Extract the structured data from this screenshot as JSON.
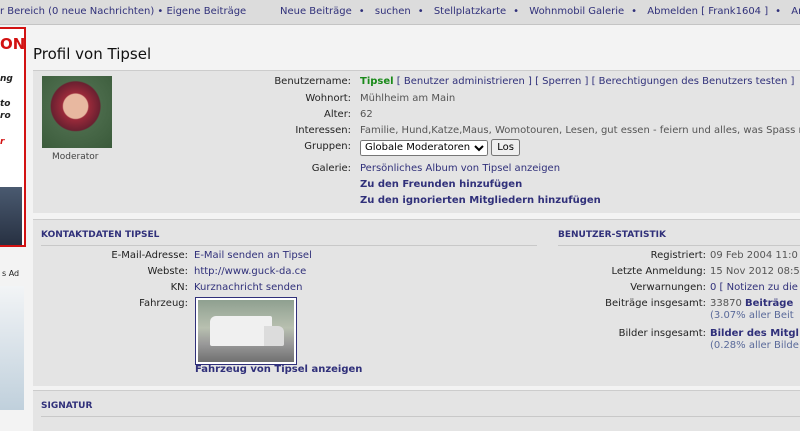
{
  "topnav": {
    "left_text": "r Bereich (0 neue Nachrichten) • Eigene Beiträge",
    "links": [
      "Neue Beiträge",
      "suchen",
      "Stellplatzkarte",
      "Wohnmobil Galerie",
      "Abmelden [ Frank1604 ]",
      "Anzeigen"
    ]
  },
  "ads": {
    "top_headline": "ON",
    "lines": [
      "ng",
      "to",
      "ro",
      "r"
    ],
    "label": "s Ad"
  },
  "page_title": "Profil von Tipsel",
  "profile": {
    "role": "Moderator",
    "rows": [
      {
        "label": "Benutzername:",
        "value": "Tipsel",
        "admin_links": "[ Benutzer administrieren ] [ Sperren ] [ Berechtigungen des Benutzers testen ]"
      },
      {
        "label": "Wohnort:",
        "value": "Mühlheim am Main"
      },
      {
        "label": "Alter:",
        "value": "62"
      },
      {
        "label": "Interessen:",
        "value": "Familie, Hund,Katze,Maus, Womotouren, Lesen, gut essen - feiern und alles, was Spass macht"
      }
    ],
    "groups_label": "Gruppen:",
    "groups_selected": "Globale Moderatoren",
    "go_button": "Los",
    "gallery_label": "Galerie:",
    "gallery_link": "Persönliches Album von Tipsel anzeigen",
    "friend_link": "Zu den Freunden hinzufügen",
    "ignore_link": "Zu den ignorierten Mitgliedern hinzufügen"
  },
  "contact": {
    "header": "KONTAKTDATEN TIPSEL",
    "email_label": "E-Mail-Adresse:",
    "email_value": "E-Mail senden an Tipsel",
    "website_label": "Webste:",
    "website_value": "http://www.guck-da.ce",
    "kn_label": "KN:",
    "kn_value": "Kurznachricht senden",
    "vehicle_label": "Fahrzeug:",
    "vehicle_link": "Fahrzeug von Tipsel anzeigen"
  },
  "stats": {
    "header": "BENUTZER-STATISTIK",
    "registered_label": "Registriert:",
    "registered_value": "09 Feb 2004 11:0",
    "last_login_label": "Letzte Anmeldung:",
    "last_login_value": "15 Nov 2012 08:5",
    "warnings_label": "Verwarnungen:",
    "warnings_value": "0 [ Notizen zu die",
    "posts_label": "Beiträge insgesamt:",
    "posts_value": "33870",
    "posts_link": "Beiträge",
    "posts_sub": "(3.07% aller Beit",
    "images_label": "Bilder insgesamt:",
    "images_link": "Bilder des Mitgl",
    "images_sub": "(0.28% aller Bilde"
  },
  "signature": {
    "header": "SIGNATUR"
  }
}
